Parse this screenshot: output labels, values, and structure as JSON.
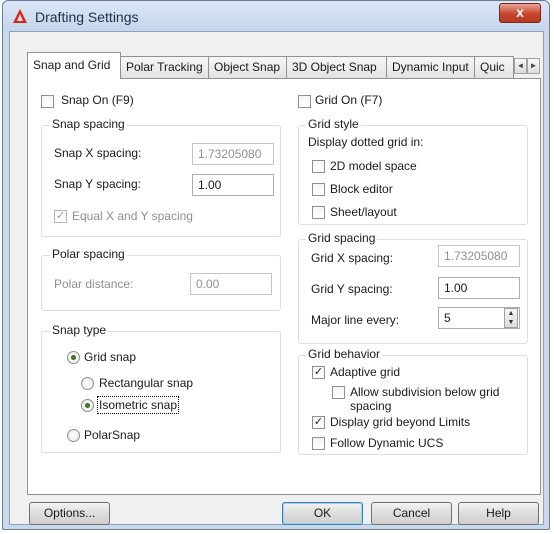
{
  "window": {
    "title": "Drafting Settings",
    "close_glyph": "x",
    "accent_color": "#c7452c"
  },
  "tabs": [
    {
      "label": "Snap and Grid",
      "active": true
    },
    {
      "label": "Polar Tracking",
      "active": false
    },
    {
      "label": "Object Snap",
      "active": false
    },
    {
      "label": "3D Object Snap",
      "active": false
    },
    {
      "label": "Dynamic Input",
      "active": false
    },
    {
      "label": "Quic",
      "active": false
    }
  ],
  "tab_scroll": {
    "left": "◄",
    "right": "►"
  },
  "snap": {
    "snap_on_label": "Snap On (F9)",
    "snap_on_checked": false,
    "spacing_group": "Snap spacing",
    "x_spacing_label": "Snap X spacing:",
    "x_spacing_value": "1.73205080",
    "y_spacing_label": "Snap Y spacing:",
    "y_spacing_value": "1.00",
    "equal_label": "Equal X and Y spacing",
    "equal_checked": true
  },
  "polar": {
    "group": "Polar spacing",
    "distance_label": "Polar distance:",
    "distance_value": "0.00"
  },
  "snap_type": {
    "group": "Snap type",
    "grid_snap": "Grid snap",
    "rectangular": "Rectangular snap",
    "isometric": "Isometric snap",
    "polarsnap": "PolarSnap",
    "selected": "isometric"
  },
  "grid": {
    "grid_on_label": "Grid On (F7)",
    "grid_on_checked": false,
    "style_group": "Grid style",
    "dotted_label": "Display dotted grid in:",
    "model_label": "2D model space",
    "block_label": "Block editor",
    "sheet_label": "Sheet/layout",
    "spacing_group": "Grid spacing",
    "x_label": "Grid X spacing:",
    "x_value": "1.73205080",
    "y_label": "Grid Y spacing:",
    "y_value": "1.00",
    "major_label": "Major line every:",
    "major_value": "5",
    "behavior_group": "Grid behavior",
    "adaptive_label": "Adaptive grid",
    "adaptive_checked": true,
    "subdivision_label_1": "Allow subdivision below grid",
    "subdivision_label_2": "spacing",
    "beyond_label": "Display grid beyond Limits",
    "beyond_checked": true,
    "follow_label": "Follow Dynamic UCS",
    "follow_checked": false
  },
  "buttons": {
    "options": "Options...",
    "ok": "OK",
    "cancel": "Cancel",
    "help": "Help"
  },
  "check_glyph": "✓"
}
